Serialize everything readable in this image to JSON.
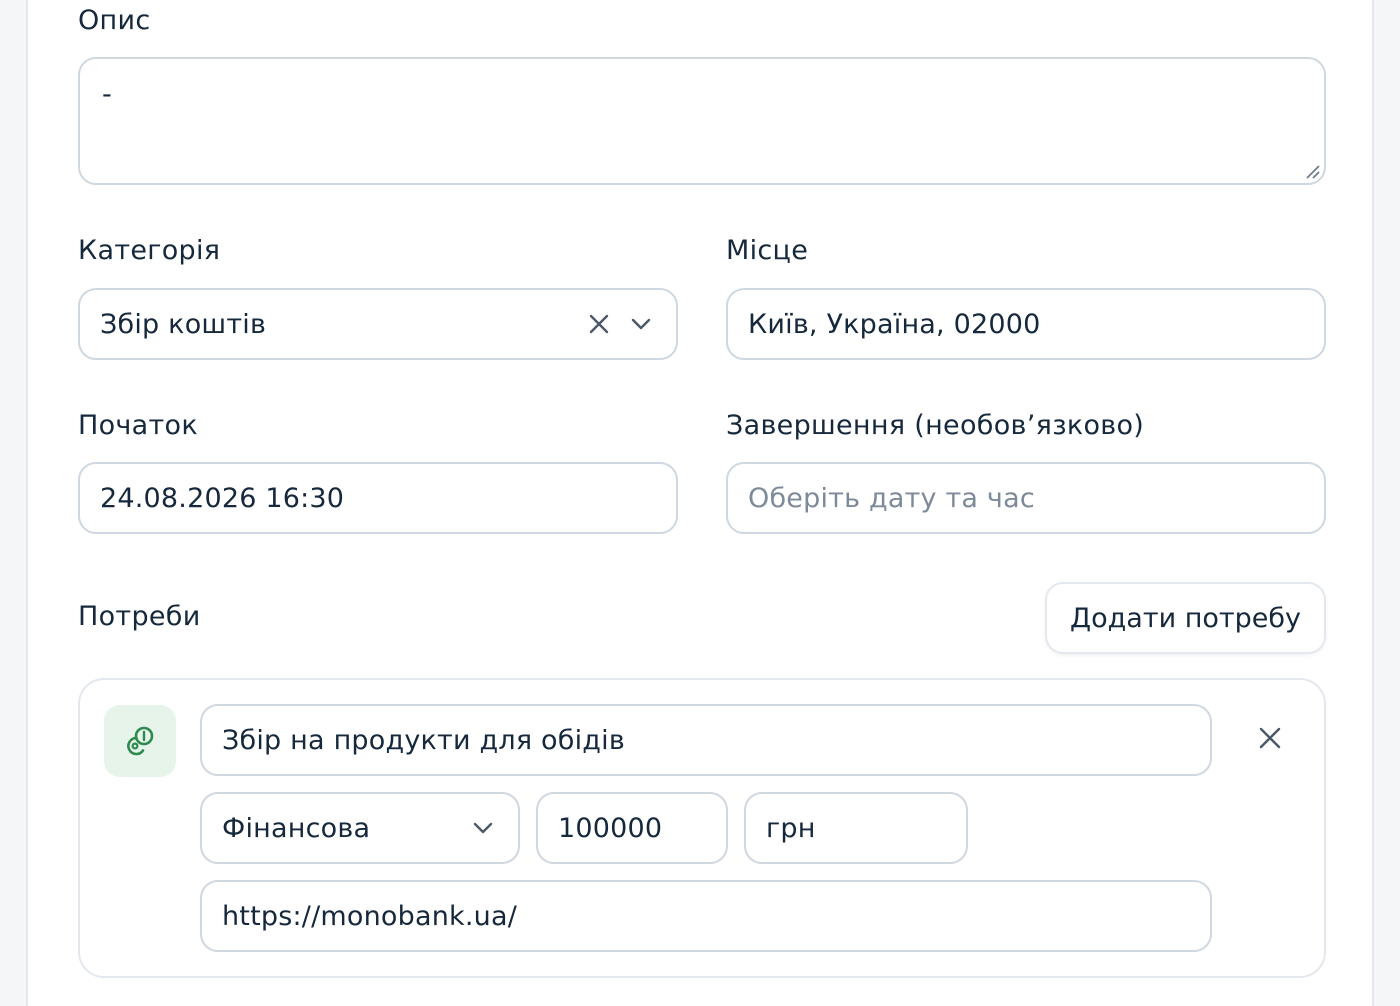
{
  "form": {
    "description": {
      "label": "Опис",
      "value": "-"
    },
    "category": {
      "label": "Категорія",
      "value": "Збір коштів"
    },
    "place": {
      "label": "Місце",
      "value": "Київ, Україна, 02000"
    },
    "start": {
      "label": "Початок",
      "value": "24.08.2026 16:30"
    },
    "end": {
      "label": "Завершення (необов’язково)",
      "placeholder": "Оберіть дату та час"
    }
  },
  "needs": {
    "label": "Потреби",
    "add_button": "Додати потребу",
    "items": [
      {
        "title": "Збір на продукти для обідів",
        "type": "Фінансова",
        "amount": "100000",
        "currency": "грн",
        "link": "https://monobank.ua/",
        "icon": "coins-icon",
        "icon_color": "#2e8b4e",
        "icon_bg": "#e6f4ea"
      }
    ]
  }
}
